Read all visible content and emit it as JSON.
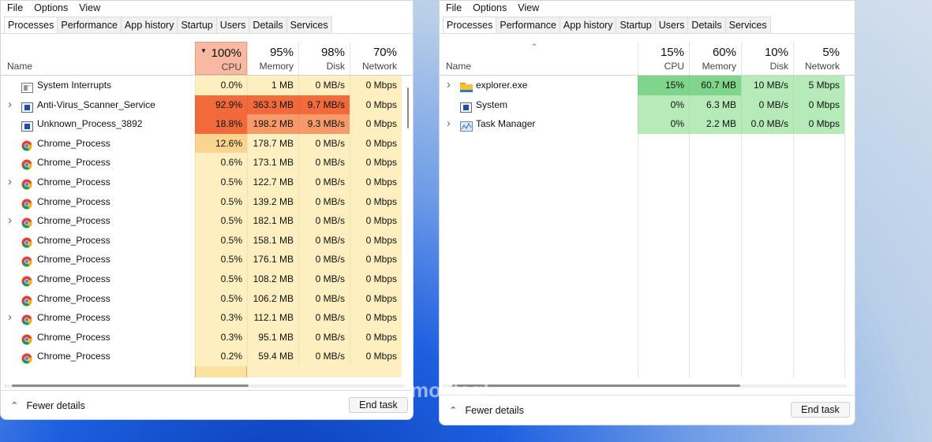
{
  "menu": [
    "File",
    "Options",
    "View"
  ],
  "tabs": [
    "Processes",
    "Performance",
    "App history",
    "Startup",
    "Users",
    "Details",
    "Services"
  ],
  "left": {
    "headers": {
      "name": "Name",
      "cpu_pct": "100%",
      "cpu": "CPU",
      "mem_pct": "95%",
      "mem": "Memory",
      "disk_pct": "98%",
      "disk": "Disk",
      "net_pct": "70%",
      "net": "Network"
    },
    "rows": [
      {
        "name": "System Interrupts",
        "icon": "system-interrupts-icon",
        "expand": false,
        "cpu": "0.0%",
        "mem": "1 MB",
        "disk": "0 MB/s",
        "net": "0 Mbps"
      },
      {
        "name": "Anti-Virus_Scanner_Service",
        "icon": "service-icon",
        "expand": true,
        "cpu": "92.9%",
        "mem": "363.3 MB",
        "disk": "9.7 MB/s",
        "net": "0 Mbps"
      },
      {
        "name": "Unknown_Process_3892",
        "icon": "service-icon",
        "expand": false,
        "cpu": "18.8%",
        "mem": "198.2 MB",
        "disk": "9.3 MB/s",
        "net": "0 Mbps"
      },
      {
        "name": "Chrome_Process",
        "icon": "chrome-icon",
        "expand": false,
        "cpu": "12.6%",
        "mem": "178.7 MB",
        "disk": "0 MB/s",
        "net": "0 Mbps"
      },
      {
        "name": "Chrome_Process",
        "icon": "chrome-icon",
        "expand": false,
        "cpu": "0.6%",
        "mem": "173.1 MB",
        "disk": "0 MB/s",
        "net": "0 Mbps"
      },
      {
        "name": "Chrome_Process",
        "icon": "chrome-icon",
        "expand": true,
        "cpu": "0.5%",
        "mem": "122.7 MB",
        "disk": "0 MB/s",
        "net": "0 Mbps"
      },
      {
        "name": "Chrome_Process",
        "icon": "chrome-icon",
        "expand": false,
        "cpu": "0.5%",
        "mem": "139.2 MB",
        "disk": "0 MB/s",
        "net": "0 Mbps"
      },
      {
        "name": "Chrome_Process",
        "icon": "chrome-icon",
        "expand": true,
        "cpu": "0.5%",
        "mem": "182.1 MB",
        "disk": "0 MB/s",
        "net": "0 Mbps"
      },
      {
        "name": "Chrome_Process",
        "icon": "chrome-icon",
        "expand": false,
        "cpu": "0.5%",
        "mem": "158.1 MB",
        "disk": "0 MB/s",
        "net": "0 Mbps"
      },
      {
        "name": "Chrome_Process",
        "icon": "chrome-icon",
        "expand": false,
        "cpu": "0.5%",
        "mem": "176.1 MB",
        "disk": "0 MB/s",
        "net": "0 Mbps"
      },
      {
        "name": "Chrome_Process",
        "icon": "chrome-icon",
        "expand": false,
        "cpu": "0.5%",
        "mem": "108.2 MB",
        "disk": "0 MB/s",
        "net": "0 Mbps"
      },
      {
        "name": "Chrome_Process",
        "icon": "chrome-icon",
        "expand": false,
        "cpu": "0.5%",
        "mem": "106.2 MB",
        "disk": "0 MB/s",
        "net": "0 Mbps"
      },
      {
        "name": "Chrome_Process",
        "icon": "chrome-icon",
        "expand": true,
        "cpu": "0.3%",
        "mem": "112.1 MB",
        "disk": "0 MB/s",
        "net": "0 Mbps"
      },
      {
        "name": "Chrome_Process",
        "icon": "chrome-icon",
        "expand": false,
        "cpu": "0.3%",
        "mem": "95.1 MB",
        "disk": "0 MB/s",
        "net": "0 Mbps"
      },
      {
        "name": "Chrome_Process",
        "icon": "chrome-icon",
        "expand": false,
        "cpu": "0.2%",
        "mem": "59.4 MB",
        "disk": "0 MB/s",
        "net": "0 Mbps"
      }
    ],
    "fewer": "Fewer details",
    "end": "End task"
  },
  "right": {
    "headers": {
      "name": "Name",
      "cpu_pct": "15%",
      "cpu": "CPU",
      "mem_pct": "60%",
      "mem": "Memory",
      "disk_pct": "10%",
      "disk": "Disk",
      "net_pct": "5%",
      "net": "Network"
    },
    "rows": [
      {
        "name": "explorer.exe",
        "icon": "folder-icon",
        "expand": true,
        "cpu": "15%",
        "mem": "60.7 MB",
        "disk": "10 MB/s",
        "net": "5 Mbps"
      },
      {
        "name": "System",
        "icon": "service-icon",
        "expand": false,
        "cpu": "0%",
        "mem": "6.3 MB",
        "disk": "0 MB/s",
        "net": "0 Mbps"
      },
      {
        "name": "Task Manager",
        "icon": "task-manager-icon",
        "expand": true,
        "cpu": "0%",
        "mem": "2.2 MB",
        "disk": "0.0 MB/s",
        "net": "0 Mbps"
      }
    ],
    "fewer": "Fewer details",
    "end": "End task"
  },
  "colors": {
    "hot": "#f26a3b",
    "warm": "#f79a6a",
    "mild": "#fbd58f",
    "cool": "#fdefbf",
    "green_dark": "#7fd68a",
    "green": "#b6eab9"
  }
}
